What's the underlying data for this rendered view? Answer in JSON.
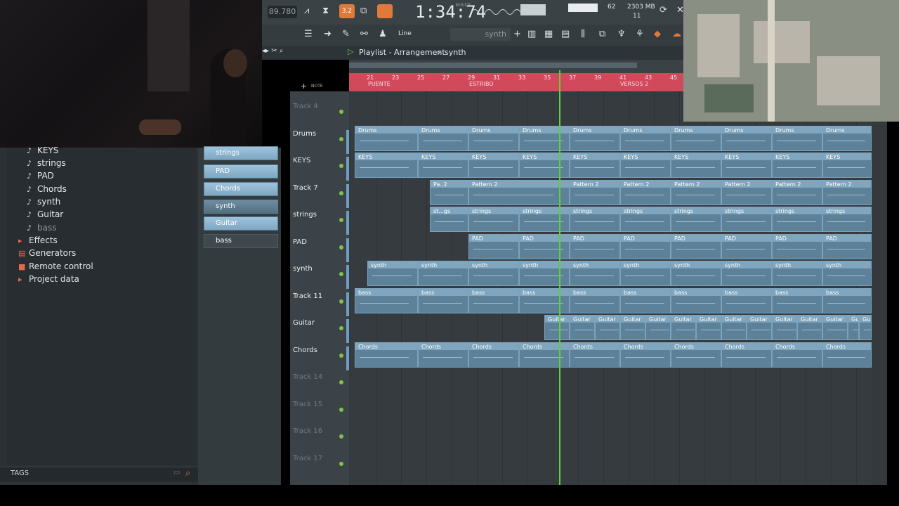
{
  "header": {
    "tempo": "89.780",
    "time": "1:34:74",
    "time_unit_top": "M:S:CS",
    "cpu": "62",
    "memory": "2303 MB",
    "voices": "11",
    "snap_mode": "Line",
    "pattern_name": "synth"
  },
  "playlist": {
    "title": "Playlist - Arrangement",
    "breadcrumb_sep": "›",
    "pattern": "synth",
    "bar_numbers": [
      "21",
      "23",
      "25",
      "27",
      "29",
      "31",
      "33",
      "35",
      "37",
      "39",
      "41",
      "43",
      "45"
    ],
    "markers": [
      "PUENTE",
      "ESTRIBO",
      "VERSOS 2"
    ]
  },
  "browser": {
    "items": [
      {
        "label": "KEYS",
        "type": "pattern"
      },
      {
        "label": "strings",
        "type": "pattern"
      },
      {
        "label": "PAD",
        "type": "pattern"
      },
      {
        "label": "Chords",
        "type": "pattern"
      },
      {
        "label": "synth",
        "type": "pattern"
      },
      {
        "label": "Guitar",
        "type": "pattern"
      },
      {
        "label": "bass",
        "type": "pattern"
      },
      {
        "label": "Effects",
        "type": "folder"
      },
      {
        "label": "Generators",
        "type": "folder"
      },
      {
        "label": "Remote control",
        "type": "folder"
      },
      {
        "label": "Project data",
        "type": "folder"
      }
    ],
    "tags_label": "TAGS"
  },
  "channels": [
    "strings",
    "PAD",
    "Chords",
    "synth",
    "Guitar",
    "bass"
  ],
  "tracks": [
    {
      "name": "Track 4",
      "empty": true
    },
    {
      "name": "Drums"
    },
    {
      "name": "KEYS"
    },
    {
      "name": "Track 7"
    },
    {
      "name": "strings"
    },
    {
      "name": "PAD"
    },
    {
      "name": "synth"
    },
    {
      "name": "Track 11"
    },
    {
      "name": "Guitar"
    },
    {
      "name": "Chords"
    },
    {
      "name": "Track 14",
      "empty": true
    },
    {
      "name": "Track 15",
      "empty": true
    },
    {
      "name": "Track 16",
      "empty": true
    },
    {
      "name": "Track 17",
      "empty": true
    }
  ],
  "clips": {
    "Drums": [
      "Drums",
      "Drums",
      "Drums",
      "Drums",
      "Drums",
      "Drums",
      "Drums",
      "Drums",
      "Drums",
      "Drums"
    ],
    "KEYS": [
      "KEYS",
      "KEYS",
      "KEYS",
      "KEYS",
      "KEYS",
      "KEYS",
      "KEYS",
      "KEYS",
      "KEYS",
      "KEYS"
    ],
    "Track 7": [
      "Pa..2",
      "Pattern 2",
      "Pattern 2",
      "Pattern 2",
      "Pattern 2",
      "Pattern 2",
      "Pattern 2",
      "Pattern 2"
    ],
    "strings": [
      "st...gs",
      "strings",
      "strings",
      "strings",
      "strings",
      "strings",
      "strings",
      "strings",
      "strings"
    ],
    "PAD": [
      "PAD",
      "PAD",
      "PAD",
      "PAD",
      "PAD",
      "PAD",
      "PAD",
      "PAD"
    ],
    "synth": [
      "synth",
      "synth",
      "synth",
      "synth",
      "synth",
      "synth",
      "synth",
      "synth",
      "synth",
      "synth"
    ],
    "Track 11": [
      "bass",
      "bass",
      "bass",
      "bass",
      "bass",
      "bass",
      "bass",
      "bass",
      "bass",
      "bass"
    ],
    "Guitar": [
      "Guitar",
      "Guitar",
      "Guitar",
      "Guitar",
      "Guitar",
      "Guitar",
      "Guitar",
      "Guitar",
      "Guitar",
      "Guitar",
      "Guitar",
      "Guitar",
      "Guitar",
      "Guitar"
    ],
    "Chords": [
      "Chords",
      "Chords",
      "Chords",
      "Chords",
      "Chords",
      "Chords",
      "Chords",
      "Chords",
      "Chords",
      "Chords"
    ]
  },
  "colors": {
    "clip": "#5c8198",
    "marker_bar": "#d14a5c",
    "playhead": "#5fd03c",
    "led": "#7ec24a"
  }
}
